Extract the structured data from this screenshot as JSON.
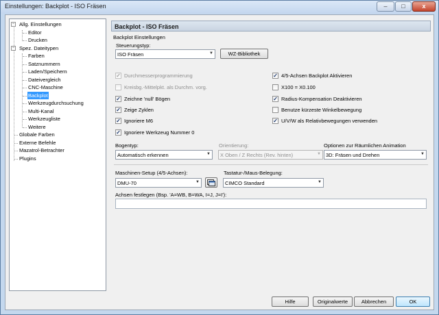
{
  "window": {
    "title": "Einstellungen: Backplot - ISO Fräsen",
    "minimize": "–",
    "maximize": "□",
    "close": "x"
  },
  "tree": {
    "items": [
      {
        "label": "Allg. Einstellungen",
        "expander": "−"
      },
      {
        "label": "Editor"
      },
      {
        "label": "Drucken"
      },
      {
        "label": "Spez. Dateitypen",
        "expander": "−"
      },
      {
        "label": "Farben"
      },
      {
        "label": "Satznummern"
      },
      {
        "label": "Laden/Speichern"
      },
      {
        "label": "Dateivergleich"
      },
      {
        "label": "CNC-Maschine"
      },
      {
        "label": "Backplot"
      },
      {
        "label": "Werkzeugdurchsuchung"
      },
      {
        "label": "Multi-Kanal"
      },
      {
        "label": "Werkzeugliste"
      },
      {
        "label": "Weitere"
      },
      {
        "label": "Globale Farben"
      },
      {
        "label": "Externe Befehle"
      },
      {
        "label": "Mazatrol-Betrachter"
      },
      {
        "label": "Plugins"
      }
    ]
  },
  "panel": {
    "header": "Backplot - ISO Fräsen",
    "group_label": "Backplot Einstellungen",
    "steuerungstyp_label": "Steuerungstyp:",
    "steuerungstyp_value": "ISO Fräsen",
    "wz_button": "WZ-Bibliothek",
    "left_checks": [
      {
        "label": "Durchmesserprogrammierung",
        "checked": true,
        "enabled": false,
        "mark": "✓"
      },
      {
        "label": "Kreisbg.-Mittelpkt. als Durchm. vorg.",
        "checked": false,
        "enabled": false,
        "mark": ""
      },
      {
        "label": "Zeichne 'null' Bögen",
        "checked": true,
        "enabled": true,
        "mark": "✓"
      },
      {
        "label": "Zeige Zyklen",
        "checked": true,
        "enabled": true,
        "mark": "✓"
      },
      {
        "label": "Ignoriere M6",
        "checked": true,
        "enabled": true,
        "mark": "✓"
      },
      {
        "label": "Ignoriere Werkzeug Nummer 0",
        "checked": true,
        "enabled": true,
        "mark": "✓"
      }
    ],
    "right_checks": [
      {
        "label": "4/5-Achsen Backplot Aktivieren",
        "checked": true,
        "mark": "✓"
      },
      {
        "label": "X100 = X0.100",
        "checked": false,
        "mark": ""
      },
      {
        "label": "Radius-Kompensation Deaktivieren",
        "checked": true,
        "mark": "✓"
      },
      {
        "label": "Benutze kürzeste Winkelbewegung",
        "checked": false,
        "mark": ""
      },
      {
        "label": "U/V/W als Relativbewegungen verwenden",
        "checked": true,
        "mark": "✓"
      }
    ],
    "bogentyp_label": "Bogentyp:",
    "bogentyp_value": "Automatisch erkennen",
    "orientierung_label": "Orientierung:",
    "orientierung_value": "X Oben  / Z Rechts (Rev. hinten)",
    "animation_label": "Optionen zur Räumlichen Animation",
    "animation_value": "3D: Fräsen und Drehen",
    "maschinen_label": "Maschinen-Setup (4/5-Achsen):",
    "maschinen_value": "DMU-70",
    "tastatur_label": "Tastatur-/Maus-Belegung:",
    "tastatur_value": "CIMCO Standard",
    "achsen_label": "Achsen festlegen (Bsp. 'A=WB, B=WA, I=J, J=I'):",
    "achsen_value": "",
    "dropdown_arrow": "▼"
  },
  "footer": {
    "hilfe": "Hilfe",
    "originalwerte": "Originalwerte",
    "abbrechen": "Abbrechen",
    "ok": "OK"
  }
}
